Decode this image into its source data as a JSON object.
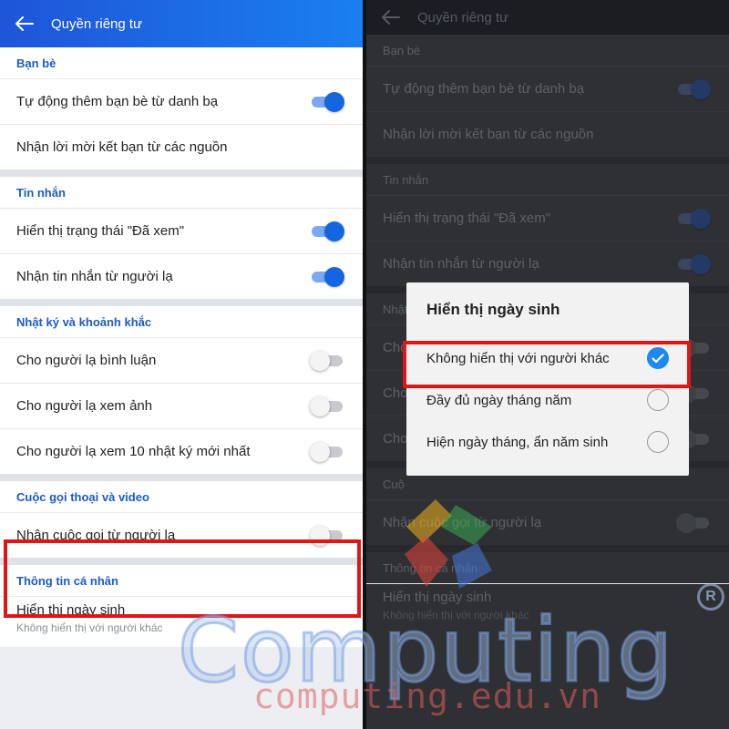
{
  "header": {
    "title": "Quyền riêng tư"
  },
  "sections": [
    {
      "title": "Bạn bè",
      "rows": [
        {
          "label": "Tự động thêm bạn bè từ danh bạ",
          "toggle": "on"
        },
        {
          "label": "Nhận lời mời kết bạn từ các nguồn",
          "toggle": null
        }
      ]
    },
    {
      "title": "Tin nhắn",
      "rows": [
        {
          "label": "Hiển thị trạng thái \"Đã xem\"",
          "toggle": "on"
        },
        {
          "label": "Nhận tin nhắn từ người lạ",
          "toggle": "on"
        }
      ]
    },
    {
      "title": "Nhật ký và khoảnh khắc",
      "rows": [
        {
          "label": "Cho người lạ bình luận",
          "toggle": "off"
        },
        {
          "label": "Cho người lạ xem ảnh",
          "toggle": "off"
        },
        {
          "label": "Cho người lạ xem 10 nhật ký mới nhất",
          "toggle": "off"
        }
      ]
    },
    {
      "title": "Cuộc gọi thoại và video",
      "rows": [
        {
          "label": "Nhận cuộc gọi từ người lạ",
          "toggle": "off"
        }
      ]
    }
  ],
  "personal": {
    "title": "Thông tin cá nhân",
    "label": "Hiển thị ngày sinh",
    "value": "Không hiển thị với người khác"
  },
  "right_partial": {
    "moments_title": "Nhật",
    "comment_row": "Cho",
    "photo_row": "Cho",
    "latest_row": "Cho",
    "call_title": "Cuộ"
  },
  "dialog": {
    "title": "Hiển thị ngày sinh",
    "options": [
      {
        "label": "Không hiển thị với người khác",
        "selected": true
      },
      {
        "label": "Đầy đủ ngày tháng năm",
        "selected": false
      },
      {
        "label": "Hiện ngày tháng, ẩn năm sinh",
        "selected": false
      }
    ]
  },
  "watermark": {
    "word": "Computing",
    "url": "computing.edu.vn",
    "reg": "R"
  },
  "colors": {
    "header_blue": "#1a6ae6",
    "accent_blue": "#1565e0",
    "section_title": "#1c5bc9",
    "highlight_red": "#e01616",
    "radio_checked": "#1e88f0"
  },
  "icons": {
    "back": "arrow-left-icon",
    "check": "checkmark-icon",
    "logo": "computing-logo"
  }
}
